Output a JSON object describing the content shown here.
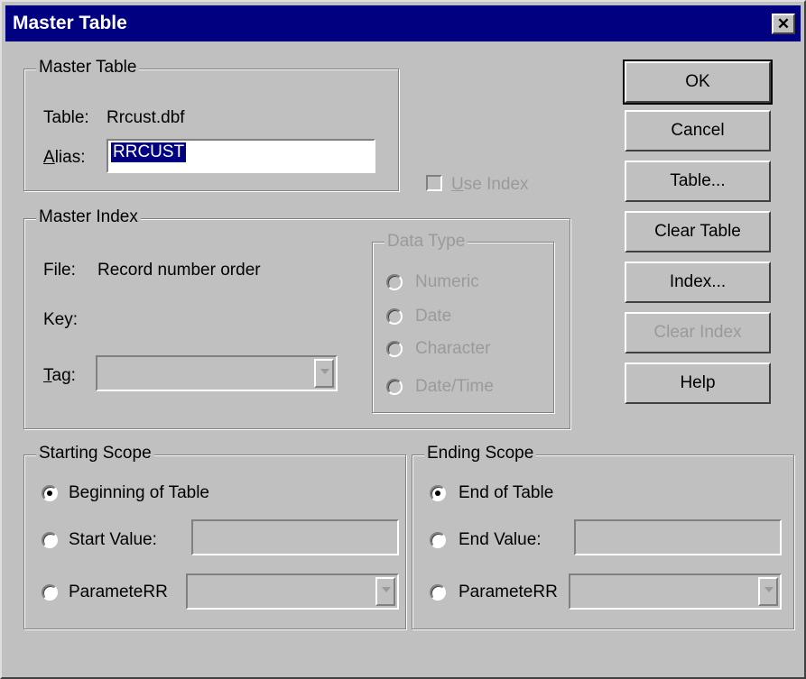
{
  "window": {
    "title": "Master Table",
    "close_symbol": "✕"
  },
  "master_table": {
    "legend": "Master Table",
    "table_label": "Table:",
    "table_value": "Rrcust.dbf",
    "alias_label": "Alias:",
    "alias_value": "RRCUST"
  },
  "use_index": {
    "label": "Use Index",
    "checked": false,
    "enabled": false
  },
  "master_index": {
    "legend": "Master Index",
    "file_label": "File:",
    "file_value": "Record number order",
    "key_label": "Key:",
    "tag_label": "Tag:",
    "tag_value": ""
  },
  "data_type": {
    "legend": "Data Type",
    "options": [
      "Numeric",
      "Date",
      "Character",
      "Date/Time"
    ]
  },
  "buttons": {
    "ok": "OK",
    "cancel": "Cancel",
    "table": "Table...",
    "clear_table": "Clear Table",
    "index": "Index...",
    "clear_index": "Clear Index",
    "help": "Help"
  },
  "starting_scope": {
    "legend": "Starting Scope",
    "beginning": "Beginning of Table",
    "start_value": "Start Value:",
    "parameter": "ParameteRR",
    "selected": "beginning"
  },
  "ending_scope": {
    "legend": "Ending Scope",
    "end": "End of Table",
    "end_value": "End Value:",
    "parameter": "ParameteRR",
    "selected": "end"
  }
}
